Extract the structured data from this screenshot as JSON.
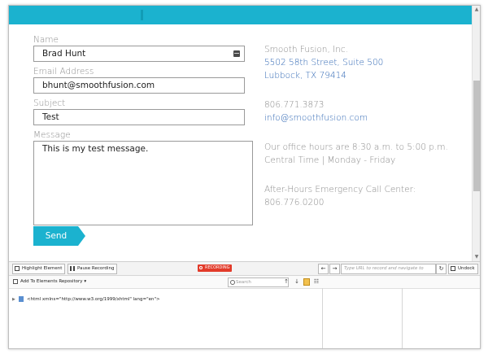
{
  "form": {
    "name_label": "Name",
    "name_value": "Brad Hunt",
    "email_label": "Email Address",
    "email_value": "bhunt@smoothfusion.com",
    "subject_label": "Subject",
    "subject_value": "Test",
    "message_label": "Message",
    "message_value": "This is my test message.",
    "send_label": "Send"
  },
  "contact": {
    "company": "Smooth Fusion, Inc.",
    "address1": "5502 58th Street, Suite 500",
    "address2": "Lubbock, TX 79414",
    "phone": "806.771.3873",
    "email": "info@smoothfusion.com",
    "hours1": "Our office hours are 8:30 a.m. to 5:00 p.m.",
    "hours2": "Central Time | Monday - Friday",
    "emergency_label": "After-Hours Emergency Call Center:",
    "emergency_phone": "806.776.0200"
  },
  "devtools": {
    "highlight_label": "Highlight Element",
    "pause_label": "Pause Recording",
    "recording_badge": "RECORDING",
    "url_placeholder": "Type URL to record and navigate to",
    "undock_label": "Undock",
    "repo_label": "Add To Elements Repository ▾",
    "search_placeholder": "Search",
    "tree_node": "<html xmlns=\"http://www.w3.org/1999/xhtml\" lang=\"en\">"
  },
  "colors": {
    "accent": "#1bb2cf",
    "link": "#2f67b4",
    "recording": "#e23b2a"
  }
}
